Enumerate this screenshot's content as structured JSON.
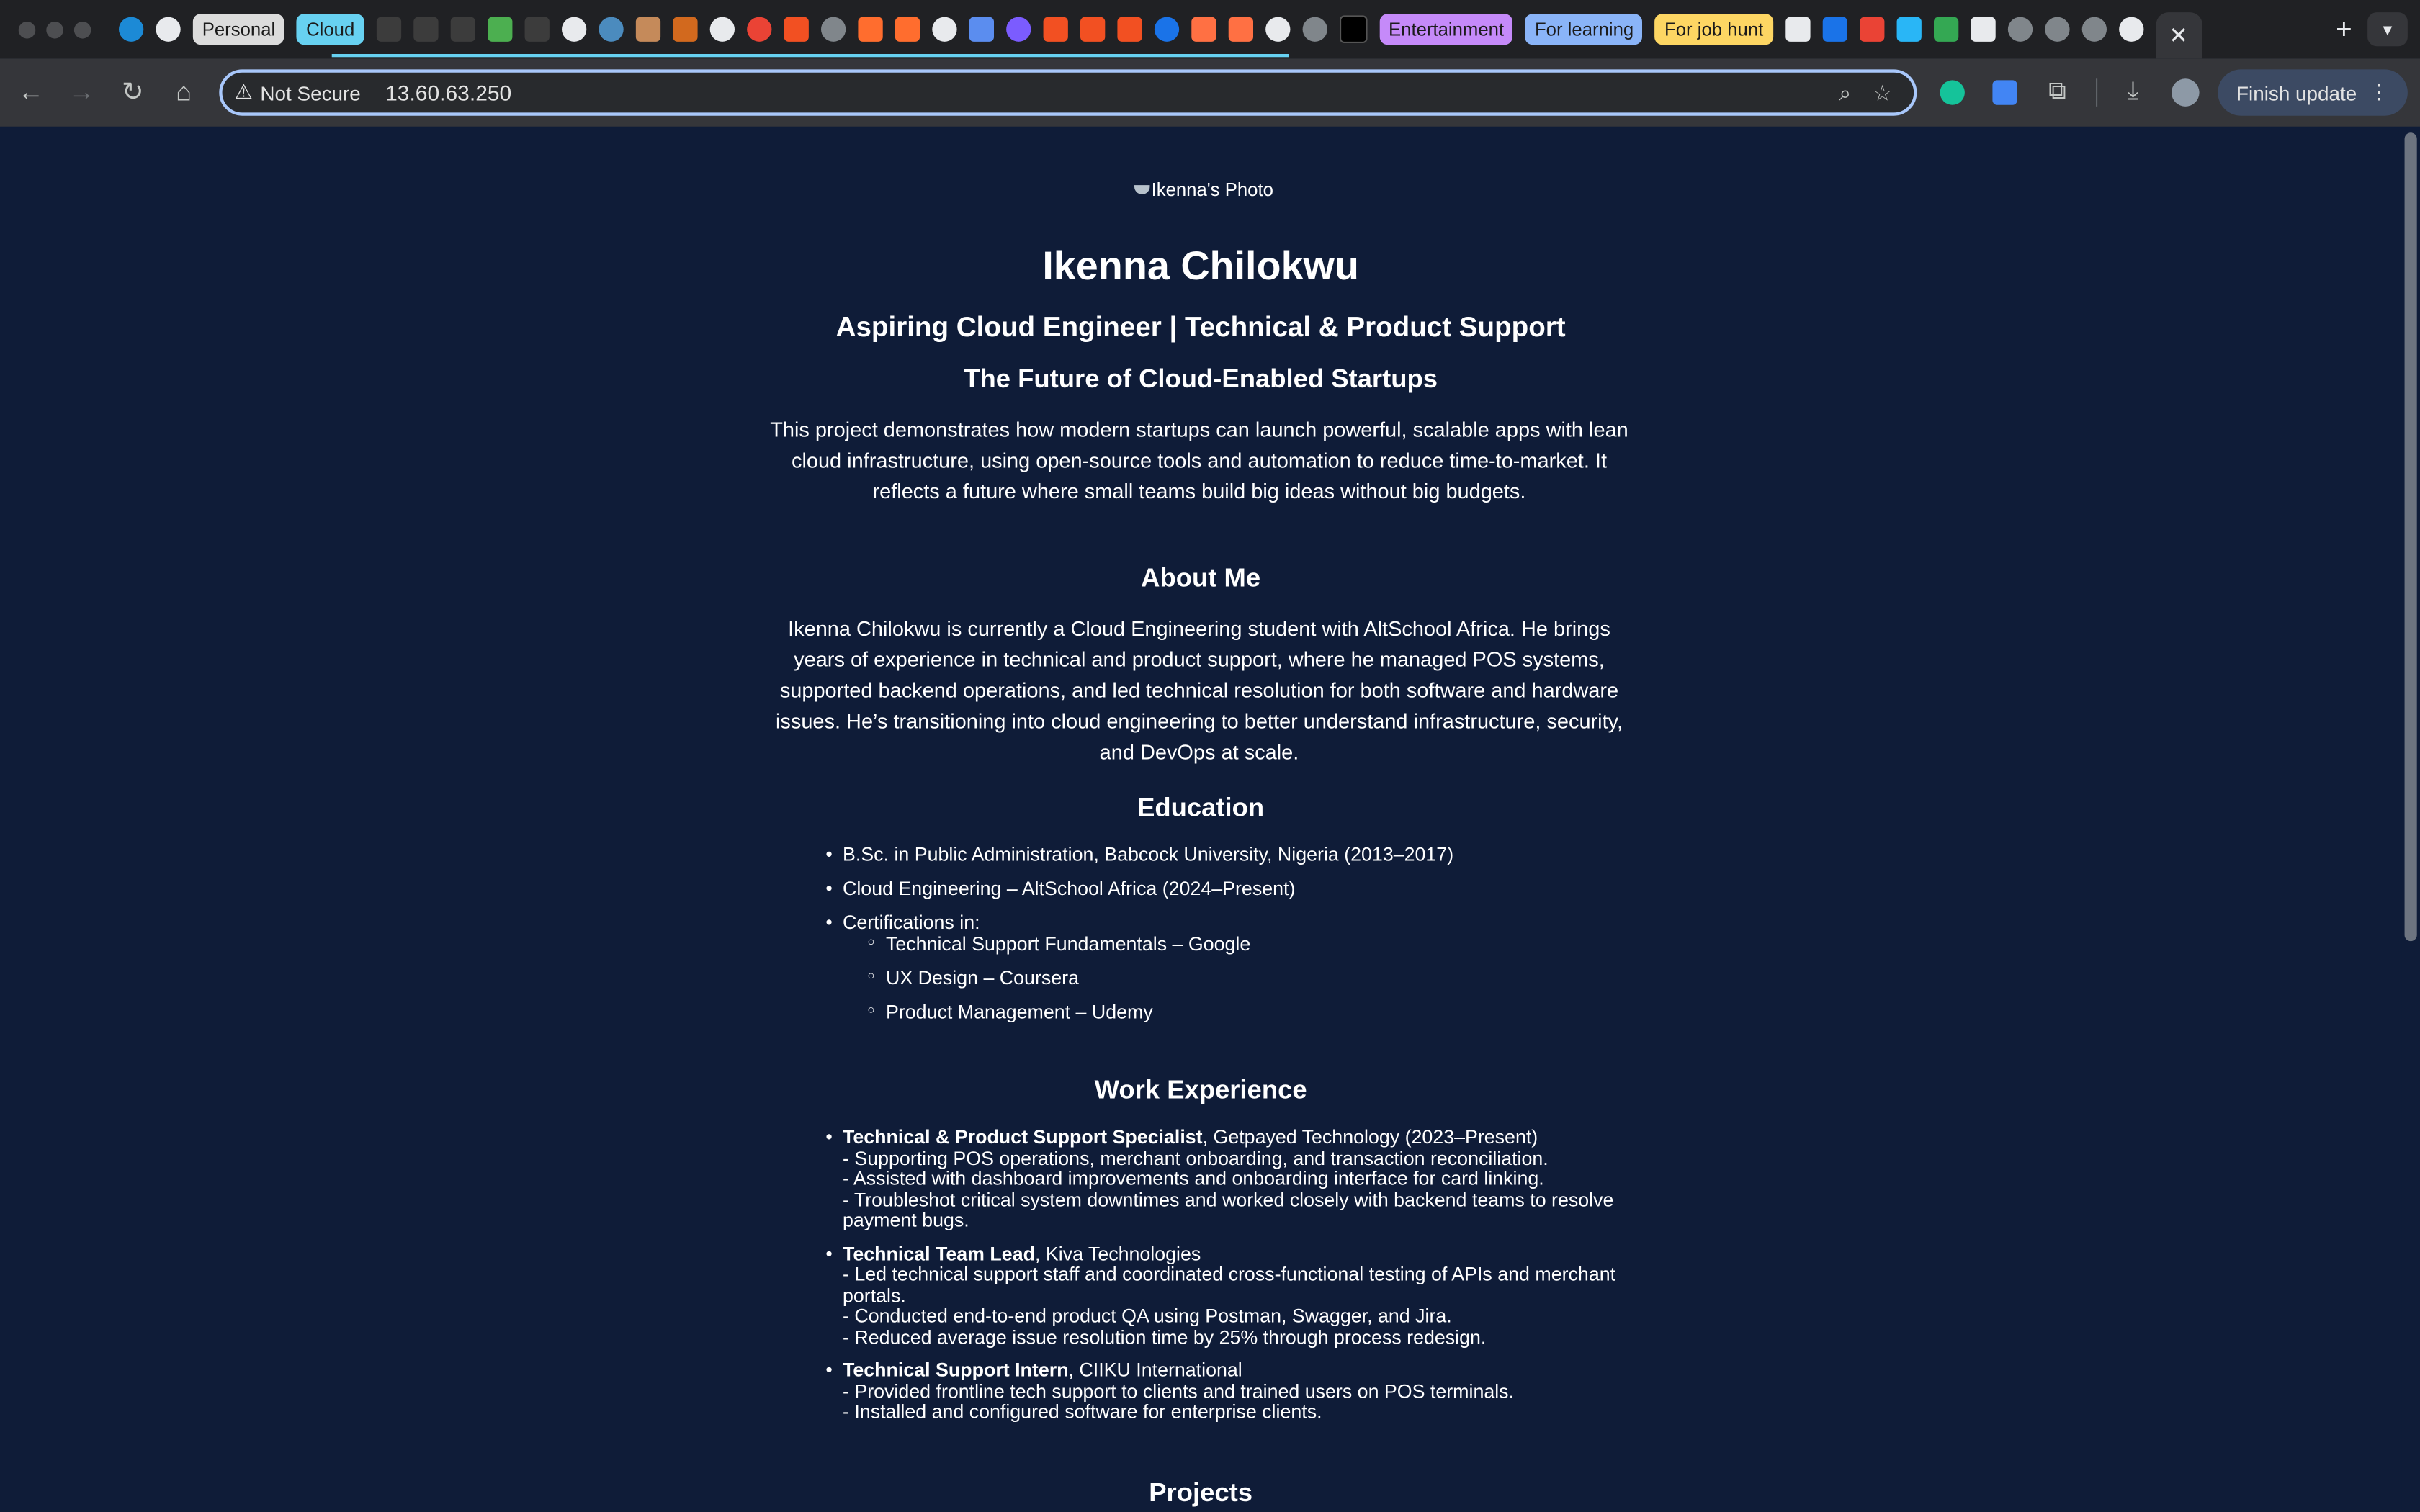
{
  "browser": {
    "tab_groups": {
      "personal": "Personal",
      "cloud": "Cloud",
      "entertainment": "Entertainment",
      "learning": "For learning",
      "job_hunt": "For job hunt"
    },
    "active_tab_close": "✕",
    "new_tab": "+",
    "security_label": "Not Secure",
    "url": "13.60.63.250",
    "finish_update_label": "Finish update",
    "colors": {
      "cloud_group": "#67d1f1",
      "entertainment_group": "#c58af9",
      "learning_group": "#8ab4f8",
      "job_group": "#fdd663",
      "page_bg": "#0f1c38"
    }
  },
  "page": {
    "photo_alt": "Ikenna's Photo",
    "name": "Ikenna Chilokwu",
    "tagline": "Aspiring Cloud Engineer | Technical & Product Support",
    "project_title": "The Future of Cloud-Enabled Startups",
    "project_desc": "This project demonstrates how modern startups can launch powerful, scalable apps with lean cloud infrastructure, using open-source tools and automation to reduce time-to-market. It reflects a future where small teams build big ideas without big budgets.",
    "about": {
      "heading": "About Me",
      "text": "Ikenna Chilokwu is currently a Cloud Engineering student with AltSchool Africa. He brings years of experience in technical and product support, where he managed POS systems, supported backend operations, and led technical resolution for both software and hardware issues. He’s transitioning into cloud engineering to better understand infrastructure, security, and DevOps at scale."
    },
    "education": {
      "heading": "Education",
      "items": [
        "B.Sc. in Public Administration, Babcock University, Nigeria (2013–2017)",
        "Cloud Engineering – AltSchool Africa (2024–Present)",
        "Certifications in:"
      ],
      "certifications": [
        "Technical Support Fundamentals – Google",
        "UX Design – Coursera",
        "Product Management – Udemy"
      ]
    },
    "work": {
      "heading": "Work Experience",
      "jobs": [
        {
          "title": "Technical & Product Support Specialist",
          "org": ", Getpayed Technology (2023–Present)",
          "lines": [
            "- Supporting POS operations, merchant onboarding, and transaction reconciliation.",
            "- Assisted with dashboard improvements and onboarding interface for card linking.",
            "- Troubleshot critical system downtimes and worked closely with backend teams to resolve payment bugs."
          ]
        },
        {
          "title": "Technical Team Lead",
          "org": ", Kiva Technologies",
          "lines": [
            "- Led technical support staff and coordinated cross-functional testing of APIs and merchant portals.",
            "- Conducted end-to-end product QA using Postman, Swagger, and Jira.",
            "- Reduced average issue resolution time by 25% through process redesign."
          ]
        },
        {
          "title": "Technical Support Intern",
          "org": ", CIIKU International",
          "lines": [
            "- Provided frontline tech support to clients and trained users on POS terminals.",
            "- Installed and configured software for enterprise clients."
          ]
        }
      ]
    },
    "projects": {
      "heading": "Projects"
    }
  }
}
